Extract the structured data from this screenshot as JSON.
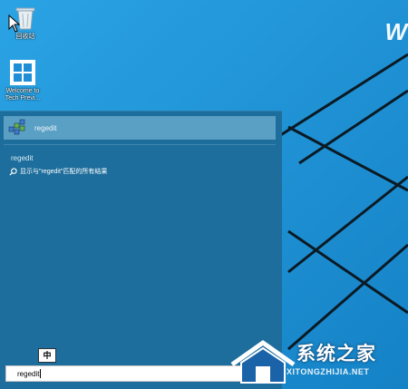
{
  "desktop": {
    "icons": [
      {
        "name": "recycle-bin",
        "label": "回收站"
      },
      {
        "name": "tech-preview",
        "label": "Welcome to Tech Previ..."
      }
    ],
    "brand_text": "W"
  },
  "search_panel": {
    "top_result": {
      "app_name": "regedit",
      "icon": "regedit-icon"
    },
    "section_heading": "regedit",
    "web_result": {
      "icon": "search-icon",
      "text": "显示与\"regedit\"匹配的所有结果"
    },
    "ime_mode": "中",
    "search_input": {
      "value": "regedit"
    }
  },
  "watermark": {
    "name_cn": "系统之家",
    "url": "XITONGZHIJIA.NET"
  },
  "colors": {
    "desktop_bg": "#1f95d8",
    "panel_bg": "#1d6e9c",
    "highlight": "#5a9fc4"
  }
}
